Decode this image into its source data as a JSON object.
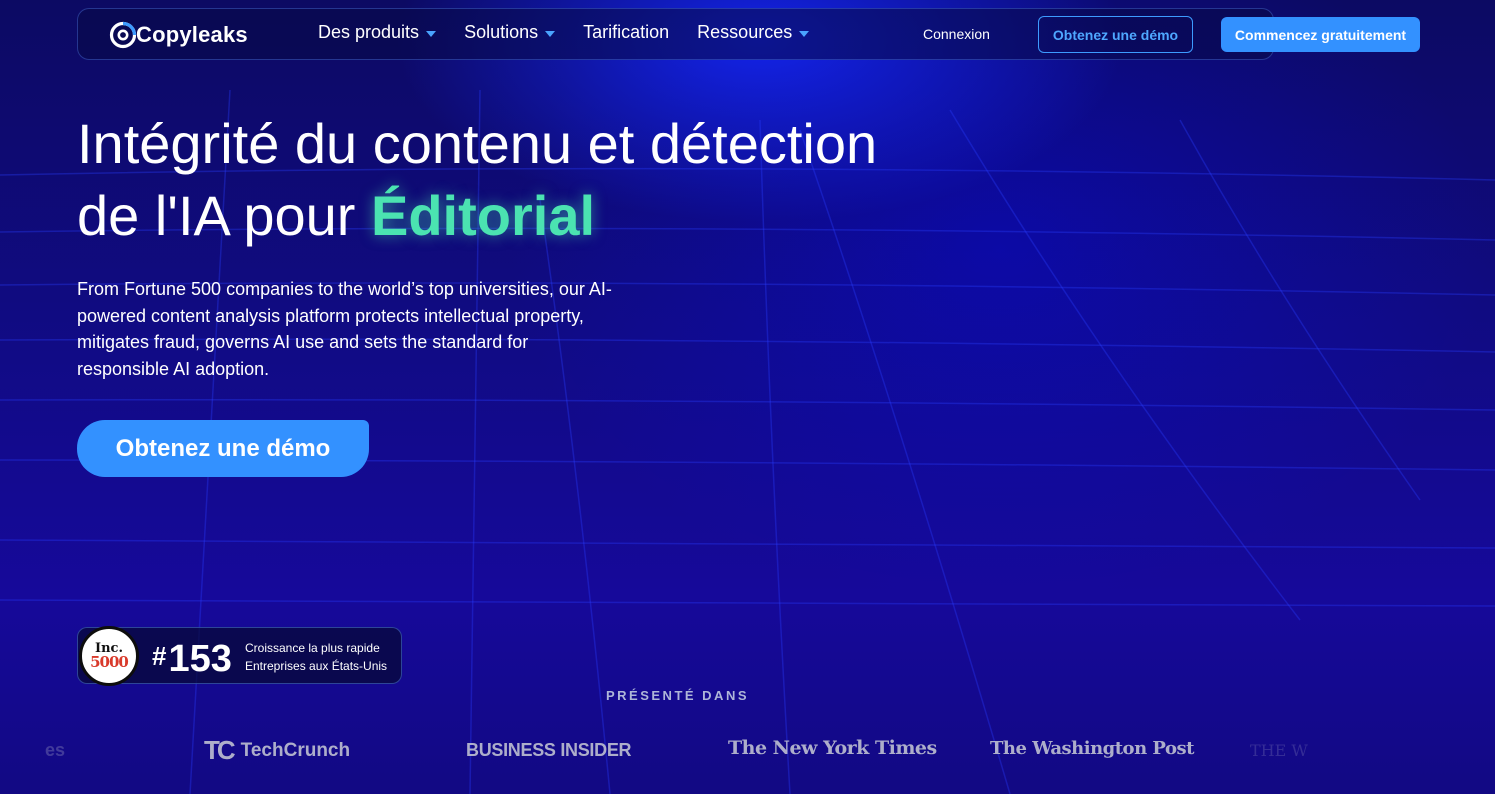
{
  "brand": {
    "name": "Copyleaks"
  },
  "nav": {
    "items": [
      {
        "label": "Des produits",
        "has_dropdown": true
      },
      {
        "label": "Solutions",
        "has_dropdown": true
      },
      {
        "label": "Tarification",
        "has_dropdown": false
      },
      {
        "label": "Ressources",
        "has_dropdown": true
      }
    ],
    "login_label": "Connexion",
    "demo_label": "Obtenez une démo",
    "start_label": "Commencez gratuitement"
  },
  "hero": {
    "title_line1": "Intégrité du contenu et détection",
    "title_line2_prefix": "de l'IA pour ",
    "title_accent": "Éditorial",
    "lead": "From Fortune 500 companies to the world’s top universities, our AI-powered content analysis platform protects intellectual property, mitigates fraud, governs AI use and sets the standard for responsible AI adoption.",
    "cta_label": "Obtenez une démo"
  },
  "badge": {
    "seal_top": "Inc.",
    "seal_bottom": "5000",
    "rank_hash": "#",
    "rank_number": "153",
    "line1": "Croissance la plus rapide",
    "line2": "Entreprises aux États-Unis"
  },
  "press": {
    "label": "PRÉSENTÉ DANS",
    "logos": [
      "TechCrunch",
      "BUSINESS INSIDER",
      "The New York Times",
      "The Washington Post"
    ]
  },
  "colors": {
    "accent_green": "#4be3b1",
    "primary_blue": "#3391ff",
    "background": "#110b86"
  }
}
